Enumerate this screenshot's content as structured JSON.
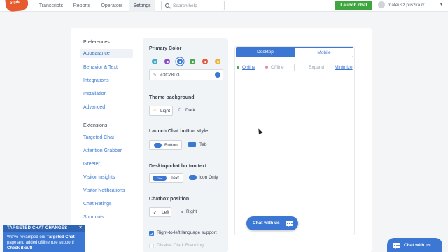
{
  "topbar": {
    "logo_text": "olark",
    "nav": [
      "Transcripts",
      "Reports",
      "Operators",
      "Settings"
    ],
    "active_nav": "Settings",
    "search_placeholder": "Search help",
    "launch_label": "Launch chat",
    "user_name": "mateusz.pliszka.rr",
    "user_caret": "▾"
  },
  "sidebar": {
    "groups": [
      {
        "title": "Preferences",
        "items": [
          "Appearance",
          "Behavior & Text",
          "Integrations",
          "Installation",
          "Advanced"
        ]
      },
      {
        "title": "Extensions",
        "items": [
          "Targeted Chat",
          "Attention Grabber",
          "Greeter",
          "Visitor Insights",
          "Visitor Notifications",
          "Chat Ratings",
          "Shortcuts"
        ]
      }
    ],
    "active_item": "Appearance"
  },
  "settings": {
    "primary_color": {
      "title": "Primary Color",
      "swatches": [
        "#45aac9",
        "#8a4fc8",
        "#3c78d3",
        "#4ba84f",
        "#e2593e",
        "#efb23a"
      ],
      "selected_index": 2,
      "value": "#3C78D3"
    },
    "theme": {
      "title": "Theme background",
      "options": [
        "Light",
        "Dark"
      ],
      "selected": "Light"
    },
    "launch_style": {
      "title": "Launch Chat button style",
      "options": [
        "Button",
        "Tab"
      ],
      "selected": "Button"
    },
    "desktop_text": {
      "title": "Desktop chat button text",
      "chip_label": "Chat",
      "options": [
        "Text",
        "Icon Only"
      ],
      "selected": "Text"
    },
    "position": {
      "title": "Chatbox position",
      "options": [
        "Left",
        "Right"
      ],
      "selected": "Left",
      "left_arrow": "↙",
      "right_arrow": "↘"
    },
    "rtl": {
      "label": "Right-to-left language support",
      "checked": true
    },
    "disable_branding": {
      "label": "Disable Olark Branding",
      "checked": false
    }
  },
  "preview": {
    "tabs": [
      "Desktop",
      "Mobile"
    ],
    "active_tab": "Desktop",
    "status": [
      "Online",
      "Offline"
    ],
    "status_colors": [
      "#4ba84f",
      "#e28bb0"
    ],
    "actions": [
      "Expand",
      "Minimize"
    ],
    "chat_button_label": "Chat with us"
  },
  "live_chat_button": {
    "label": "Chat with us"
  },
  "notification": {
    "title": "TARGETED CHAT CHANGES",
    "close": "×",
    "body_1": "We've revamped our ",
    "body_link": "Targeted Chat",
    "body_2": " page and added offline rule support! ",
    "cta": "Check it out!"
  },
  "colors": {
    "accent": "#3c78d3",
    "launch_green": "#3fa63f",
    "brand_orange": "#e65c2e"
  }
}
